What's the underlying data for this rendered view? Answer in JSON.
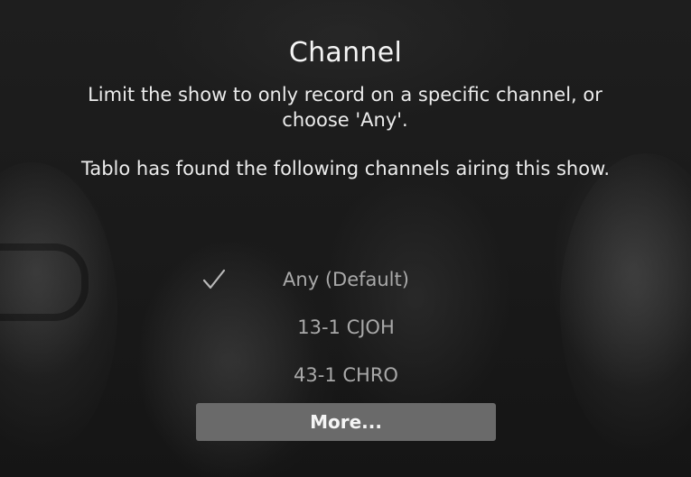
{
  "dialog": {
    "title": "Channel",
    "description": "Limit the show to only record on a specific channel, or choose 'Any'.",
    "found_note": "Tablo has found the following channels airing this show."
  },
  "channels": [
    {
      "label": "Any (Default)",
      "selected": true
    },
    {
      "label": "13-1 CJOH",
      "selected": false
    },
    {
      "label": "43-1 CHRO",
      "selected": false
    }
  ],
  "more_button": {
    "label": "More..."
  },
  "icons": {
    "selected_indicator": "check-icon"
  },
  "colors": {
    "background": "#1a1a1a",
    "text_primary": "#f4f4f4",
    "text_dimmed": "#a9a9a9",
    "button": "#6a6a6a"
  }
}
